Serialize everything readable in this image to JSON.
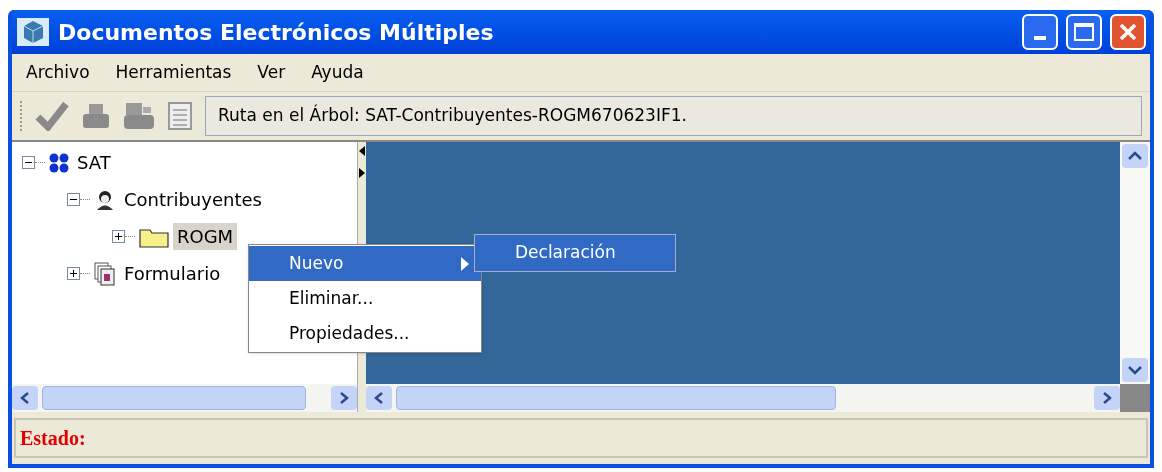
{
  "window": {
    "title": "Documentos Electrónicos Múltiples"
  },
  "menu_bar": [
    "Archivo",
    "Herramientas",
    "Ver",
    "Ayuda"
  ],
  "toolbar": {
    "path": "Ruta en el Árbol: SAT-Contribuyentes-ROGM670623IF1."
  },
  "tree": [
    {
      "label": "SAT",
      "kind": "root",
      "expanded": true,
      "selected": false,
      "children": [
        {
          "label": "Contribuyentes",
          "kind": "person",
          "expanded": true,
          "selected": false,
          "children": [
            {
              "label": "ROGM",
              "kind": "folder",
              "expanded": false,
              "selected": true
            }
          ]
        },
        {
          "label": "Formulario",
          "kind": "forms",
          "expanded": false,
          "selected": false
        }
      ]
    }
  ],
  "context_menu": [
    {
      "label": "Nuevo",
      "selected": true,
      "submenu": true
    },
    {
      "label": "Eliminar...",
      "selected": false,
      "submenu": false
    },
    {
      "label": "Propiedades...",
      "selected": false,
      "submenu": false
    }
  ],
  "submenu": [
    {
      "label": "Declaración",
      "selected": true
    }
  ],
  "status_bar": {
    "label": "Estado:"
  }
}
